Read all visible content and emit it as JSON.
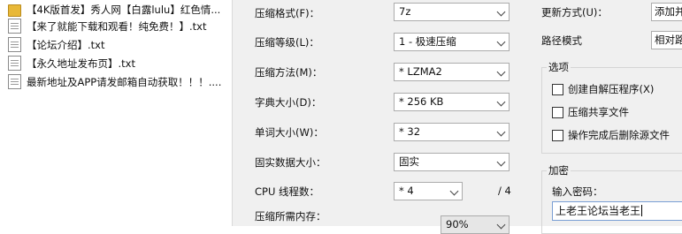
{
  "files": [
    {
      "icon": "folder-icon",
      "name": "【4K版首发】秀人网【白露lulu】红色情..."
    },
    {
      "icon": "text-file-icon",
      "name": "【来了就能下载和观看！纯免费！】.txt"
    },
    {
      "icon": "text-file-icon",
      "name": "【论坛介绍】.txt"
    },
    {
      "icon": "text-file-icon",
      "name": "【永久地址发布页】.txt"
    },
    {
      "icon": "text-file-icon",
      "name": "最新地址及APP请发邮箱自动获取！！！...."
    }
  ],
  "settings": {
    "format": {
      "label": "压缩格式(F)：",
      "value": "7z"
    },
    "level": {
      "label": "压缩等级(L)：",
      "value": "1 - 极速压缩"
    },
    "method": {
      "label": "压缩方法(M)：",
      "value": "* LZMA2"
    },
    "dict": {
      "label": "字典大小(D)：",
      "value": "* 256 KB"
    },
    "word": {
      "label": "单词大小(W)：",
      "value": "* 32"
    },
    "solid": {
      "label": "固实数据大小：",
      "value": "固实"
    },
    "threads": {
      "label": "CPU 线程数：",
      "value": "* 4",
      "max": "/ 4"
    },
    "memory": {
      "label": "压缩所需内存：",
      "value": "90%"
    }
  },
  "update": {
    "label": "更新方式(U)：",
    "value": "添加并"
  },
  "path": {
    "label": "路径模式",
    "value": "相对路"
  },
  "options": {
    "title": "选项",
    "sfx": "创建自解压程序(X)",
    "shared": "压缩共享文件",
    "delete_after": "操作完成后删除源文件"
  },
  "encryption": {
    "title": "加密",
    "password_label": "输入密码：",
    "password_value": "上老王论坛当老王"
  }
}
